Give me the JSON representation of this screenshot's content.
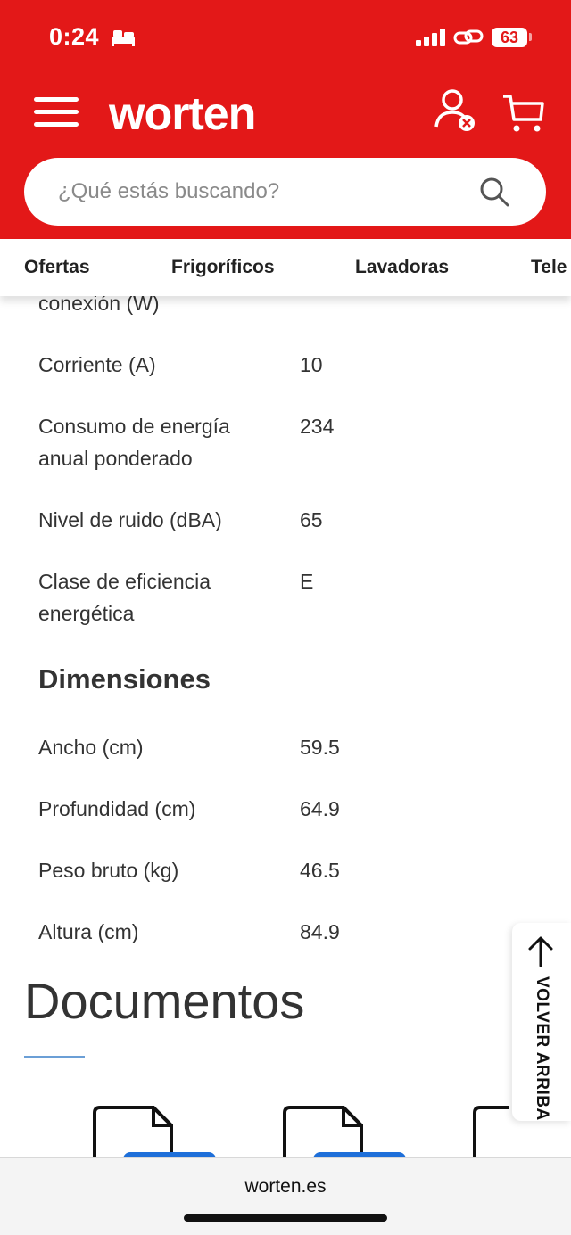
{
  "status_bar": {
    "time": "0:24",
    "battery": "63"
  },
  "header": {
    "logo": "worten",
    "search_placeholder": "¿Qué estás buscando?",
    "brand_color": "#e31818"
  },
  "categories": [
    "Ofertas",
    "Frigoríficos",
    "Lavadoras",
    "Tele"
  ],
  "specs_partial_label": "conexión (W)",
  "specs": [
    {
      "label": "Corriente (A)",
      "value": "10"
    },
    {
      "label": "Consumo de energía anual ponderado",
      "value": "234"
    },
    {
      "label": "Nivel de ruido (dBA)",
      "value": "65"
    },
    {
      "label": "Clase de eficiencia energética",
      "value": "E"
    }
  ],
  "dimensions": {
    "title": "Dimensiones",
    "items": [
      {
        "label": "Ancho (cm)",
        "value": "59.5"
      },
      {
        "label": "Profundidad (cm)",
        "value": "64.9"
      },
      {
        "label": "Peso bruto (kg)",
        "value": "46.5"
      },
      {
        "label": "Altura (cm)",
        "value": "84.9"
      }
    ]
  },
  "documents": {
    "title": "Documentos"
  },
  "back_to_top": "VOLVER ARRIBA",
  "browser": {
    "url": "worten.es"
  }
}
